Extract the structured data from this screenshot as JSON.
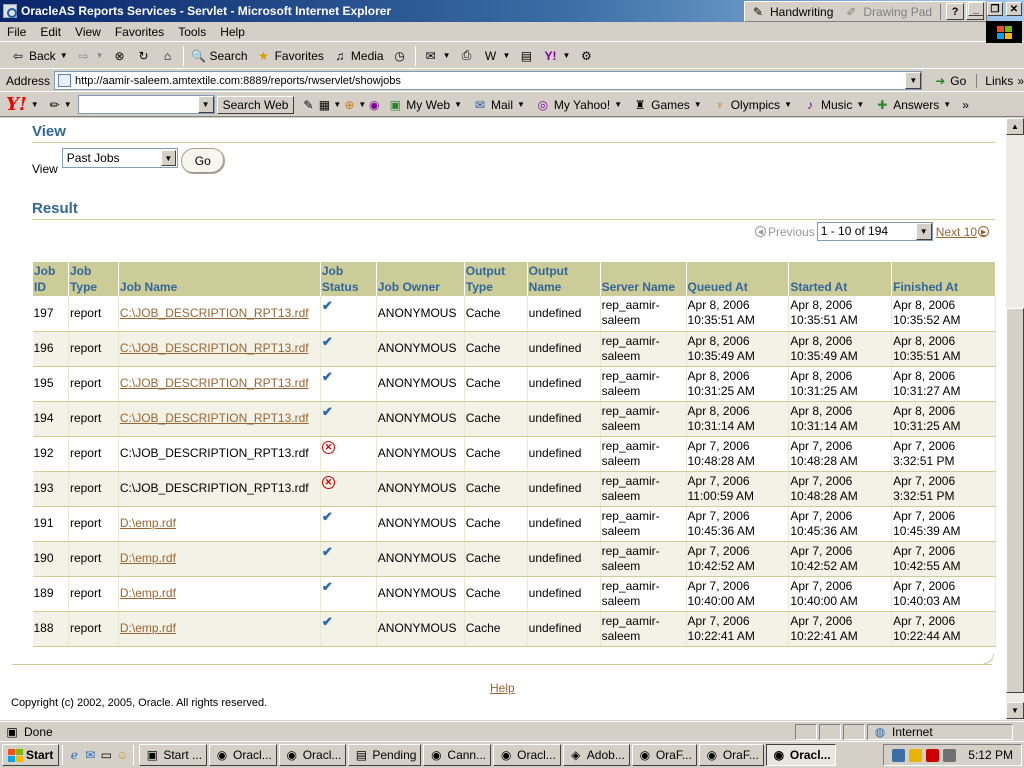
{
  "window": {
    "title": "OracleAS Reports Services - Servlet - Microsoft Internet Explorer",
    "handwriting_label": "Handwriting",
    "drawing_pad_label": "Drawing Pad",
    "help_glyph": "?"
  },
  "menu": [
    "File",
    "Edit",
    "View",
    "Favorites",
    "Tools",
    "Help"
  ],
  "toolbar": {
    "back_label": "Back",
    "search_label": "Search",
    "favorites_label": "Favorites",
    "media_label": "Media"
  },
  "address": {
    "label": "Address",
    "url": "http://aamir-saleem.amtextile.com:8889/reports/rwservlet/showjobs",
    "go_label": "Go",
    "links_label": "Links"
  },
  "yahoo": {
    "logo": "Y!",
    "search_button": "Search Web",
    "items": [
      "My Web",
      "Mail",
      "My Yahoo!",
      "Games",
      "Olympics",
      "Music",
      "Answers"
    ]
  },
  "page": {
    "view_heading": "View",
    "view_label": "View",
    "view_select": "Past Jobs",
    "go_button": "Go",
    "result_heading": "Result",
    "previous_label": "Previous",
    "range_select": "1 - 10 of 194",
    "next_label": "Next 10",
    "help_link": "Help",
    "copyright": "Copyright (c) 2002, 2005, Oracle. All rights reserved."
  },
  "table": {
    "headers": [
      "Job ID",
      "Job Type",
      "Job Name",
      "Job Status",
      "Job Owner",
      "Output Type",
      "Output Name",
      "Server Name",
      "Queued At",
      "Started At",
      "Finished At"
    ],
    "rows": [
      {
        "id": "197",
        "type": "report",
        "name": "C:\\JOB_DESCRIPTION_RPT13.rdf",
        "link": true,
        "status": "success",
        "owner": "ANONYMOUS",
        "out_type": "Cache",
        "out_name": "undefined",
        "server": "rep_aamir-saleem",
        "queued": "Apr 8, 2006 10:35:51 AM",
        "started": "Apr 8, 2006 10:35:51 AM",
        "finished": "Apr 8, 2006 10:35:52 AM"
      },
      {
        "id": "196",
        "type": "report",
        "name": "C:\\JOB_DESCRIPTION_RPT13.rdf",
        "link": true,
        "status": "success",
        "owner": "ANONYMOUS",
        "out_type": "Cache",
        "out_name": "undefined",
        "server": "rep_aamir-saleem",
        "queued": "Apr 8, 2006 10:35:49 AM",
        "started": "Apr 8, 2006 10:35:49 AM",
        "finished": "Apr 8, 2006 10:35:51 AM"
      },
      {
        "id": "195",
        "type": "report",
        "name": "C:\\JOB_DESCRIPTION_RPT13.rdf",
        "link": true,
        "status": "success",
        "owner": "ANONYMOUS",
        "out_type": "Cache",
        "out_name": "undefined",
        "server": "rep_aamir-saleem",
        "queued": "Apr 8, 2006 10:31:25 AM",
        "started": "Apr 8, 2006 10:31:25 AM",
        "finished": "Apr 8, 2006 10:31:27 AM"
      },
      {
        "id": "194",
        "type": "report",
        "name": "C:\\JOB_DESCRIPTION_RPT13.rdf",
        "link": true,
        "status": "success",
        "owner": "ANONYMOUS",
        "out_type": "Cache",
        "out_name": "undefined",
        "server": "rep_aamir-saleem",
        "queued": "Apr 8, 2006 10:31:14 AM",
        "started": "Apr 8, 2006 10:31:14 AM",
        "finished": "Apr 8, 2006 10:31:25 AM"
      },
      {
        "id": "192",
        "type": "report",
        "name": "C:\\JOB_DESCRIPTION_RPT13.rdf",
        "link": false,
        "status": "failed",
        "owner": "ANONYMOUS",
        "out_type": "Cache",
        "out_name": "undefined",
        "server": "rep_aamir-saleem",
        "queued": "Apr 7, 2006 10:48:28 AM",
        "started": "Apr 7, 2006 10:48:28 AM",
        "finished": "Apr 7, 2006 3:32:51 PM"
      },
      {
        "id": "193",
        "type": "report",
        "name": "C:\\JOB_DESCRIPTION_RPT13.rdf",
        "link": false,
        "status": "failed",
        "owner": "ANONYMOUS",
        "out_type": "Cache",
        "out_name": "undefined",
        "server": "rep_aamir-saleem",
        "queued": "Apr 7, 2006 11:00:59 AM",
        "started": "Apr 7, 2006 10:48:28 AM",
        "finished": "Apr 7, 2006 3:32:51 PM"
      },
      {
        "id": "191",
        "type": "report",
        "name": "D:\\emp.rdf",
        "link": true,
        "status": "success",
        "owner": "ANONYMOUS",
        "out_type": "Cache",
        "out_name": "undefined",
        "server": "rep_aamir-saleem",
        "queued": "Apr 7, 2006 10:45:36 AM",
        "started": "Apr 7, 2006 10:45:36 AM",
        "finished": "Apr 7, 2006 10:45:39 AM"
      },
      {
        "id": "190",
        "type": "report",
        "name": "D:\\emp.rdf",
        "link": true,
        "status": "success",
        "owner": "ANONYMOUS",
        "out_type": "Cache",
        "out_name": "undefined",
        "server": "rep_aamir-saleem",
        "queued": "Apr 7, 2006 10:42:52 AM",
        "started": "Apr 7, 2006 10:42:52 AM",
        "finished": "Apr 7, 2006 10:42:55 AM"
      },
      {
        "id": "189",
        "type": "report",
        "name": "D:\\emp.rdf",
        "link": true,
        "status": "success",
        "owner": "ANONYMOUS",
        "out_type": "Cache",
        "out_name": "undefined",
        "server": "rep_aamir-saleem",
        "queued": "Apr 7, 2006 10:40:00 AM",
        "started": "Apr 7, 2006 10:40:00 AM",
        "finished": "Apr 7, 2006 10:40:03 AM"
      },
      {
        "id": "188",
        "type": "report",
        "name": "D:\\emp.rdf",
        "link": true,
        "status": "success",
        "owner": "ANONYMOUS",
        "out_type": "Cache",
        "out_name": "undefined",
        "server": "rep_aamir-saleem",
        "queued": "Apr 7, 2006 10:22:41 AM",
        "started": "Apr 7, 2006 10:22:41 AM",
        "finished": "Apr 7, 2006 10:22:44 AM"
      }
    ]
  },
  "statusbar": {
    "status_text": "Done",
    "zone": "Internet"
  },
  "taskbar": {
    "start_label": "Start",
    "items": [
      "Start ...",
      "Oracl...",
      "Oracl...",
      "Pending",
      "Cann...",
      "Oracl...",
      "Adob...",
      "OraF...",
      "OraF...",
      "Oracl..."
    ],
    "active_index": 9,
    "clock": "5:12 PM"
  },
  "colors": {
    "header_bg": "#cccc99",
    "header_text": "#336699",
    "link": "#996633",
    "alt_row": "#f2f2e6"
  }
}
